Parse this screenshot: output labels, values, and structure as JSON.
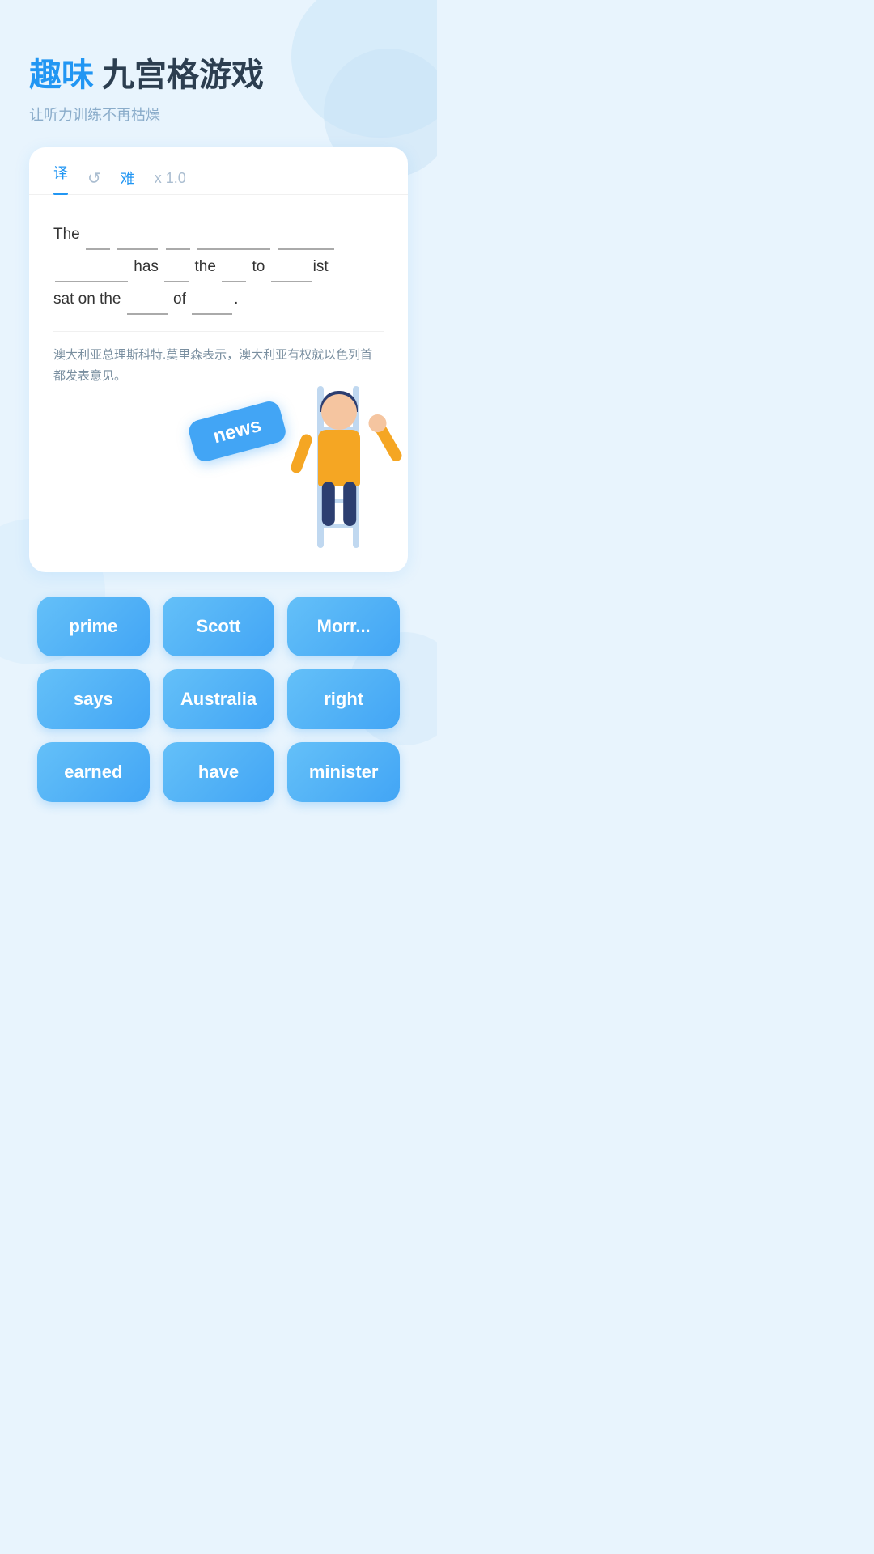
{
  "header": {
    "title_blue": "趣味",
    "title_dark": "九宫格游戏",
    "subtitle": "让听力训练不再枯燥"
  },
  "tabs": {
    "translate": "译",
    "refresh": "↺",
    "difficulty": "难",
    "speed": "x 1.0"
  },
  "sentence": {
    "text_part1": "The",
    "text_part2": "has",
    "text_part3": "the",
    "text_part4": "to",
    "text_part5": "ist sat on the",
    "text_part6": "of",
    "translation": "澳大利亚总理斯科特.莫里森表示，澳大利亚有权就以色列首都发表意见。"
  },
  "news_chip": {
    "label": "news"
  },
  "word_buttons": [
    {
      "label": "prime",
      "id": "prime"
    },
    {
      "label": "Scott",
      "id": "scott"
    },
    {
      "label": "Morr...",
      "id": "morrison"
    },
    {
      "label": "says",
      "id": "says"
    },
    {
      "label": "Australia",
      "id": "australia"
    },
    {
      "label": "right",
      "id": "right"
    },
    {
      "label": "earned",
      "id": "earned"
    },
    {
      "label": "have",
      "id": "have"
    },
    {
      "label": "minister",
      "id": "minister"
    }
  ]
}
